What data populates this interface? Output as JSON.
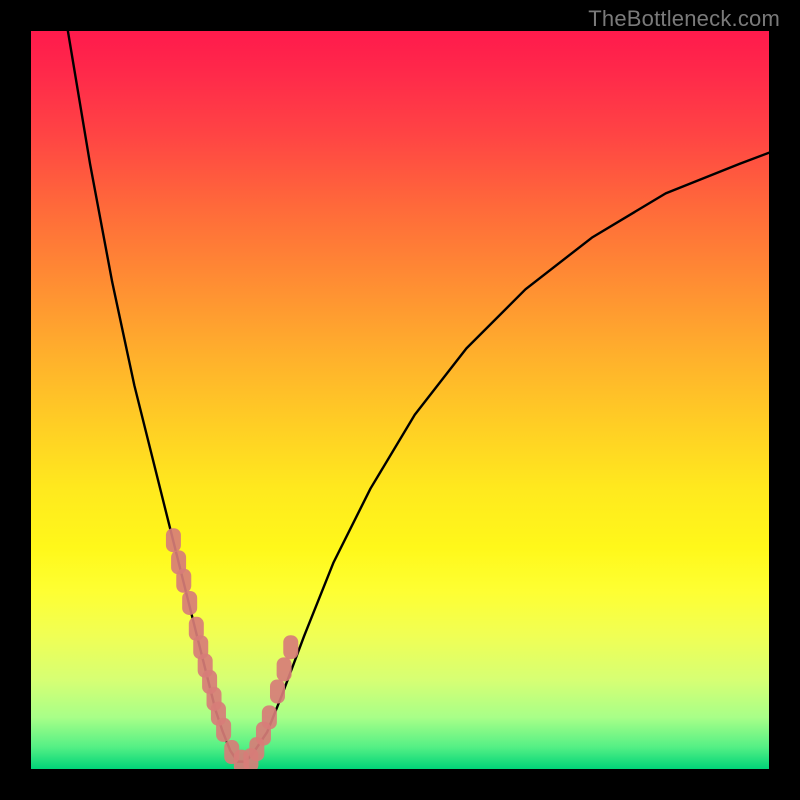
{
  "watermark": {
    "text": "TheBottleneck.com"
  },
  "chart_data": {
    "type": "line",
    "title": "",
    "xlabel": "",
    "ylabel": "",
    "xlim": [
      0,
      100
    ],
    "ylim": [
      0,
      100
    ],
    "grid": false,
    "legend": false,
    "series": [
      {
        "name": "bottleneck-curve",
        "type": "line",
        "color": "#000000",
        "x": [
          5,
          8,
          11,
          14,
          17,
          19,
          21,
          22.5,
          24,
          25,
          26,
          27,
          28,
          29,
          30,
          32,
          34,
          37,
          41,
          46,
          52,
          59,
          67,
          76,
          86,
          96,
          100
        ],
        "y": [
          100,
          82,
          66,
          52,
          40,
          32,
          24,
          18,
          12,
          8,
          5,
          2.5,
          1,
          1,
          2,
          5,
          10,
          18,
          28,
          38,
          48,
          57,
          65,
          72,
          78,
          82,
          83.5
        ]
      },
      {
        "name": "curve-markers",
        "type": "scatter",
        "color": "#d77d78",
        "x": [
          19.3,
          20.0,
          20.7,
          21.5,
          22.4,
          23.0,
          23.6,
          24.2,
          24.8,
          25.4,
          26.1,
          27.2,
          28.5,
          29.8,
          30.6,
          31.5,
          32.3,
          33.4,
          34.3,
          35.2
        ],
        "y": [
          31.0,
          28.0,
          25.5,
          22.5,
          19.0,
          16.5,
          14.0,
          11.8,
          9.5,
          7.5,
          5.3,
          2.3,
          1.0,
          1.2,
          2.7,
          4.8,
          7.0,
          10.5,
          13.5,
          16.5
        ]
      }
    ]
  }
}
